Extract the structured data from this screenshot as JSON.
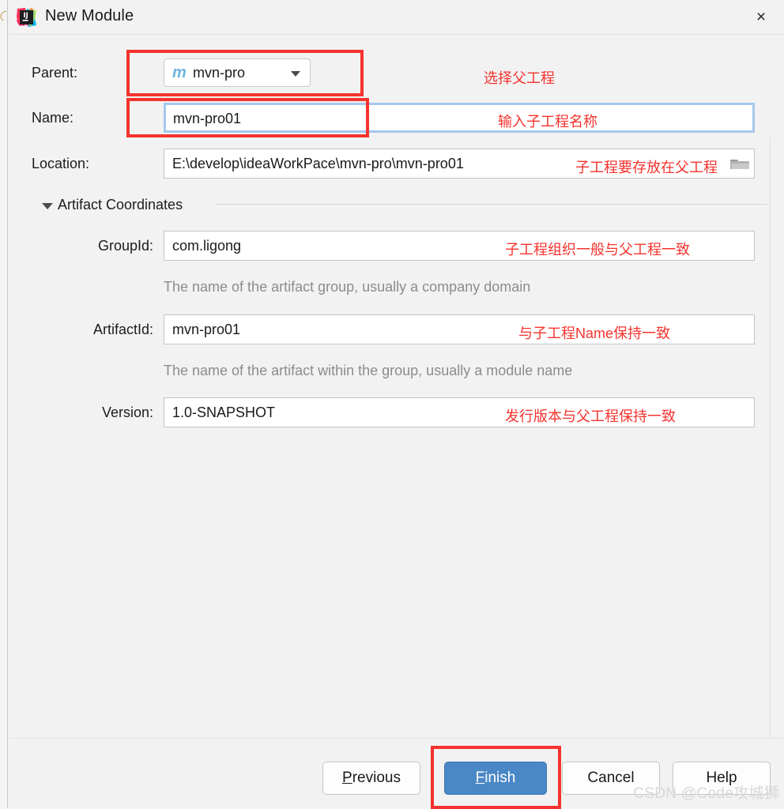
{
  "window": {
    "title": "New Module",
    "icon": "intellij-idea-icon",
    "close_label": "×"
  },
  "form": {
    "parent": {
      "label": "Parent:",
      "value": "mvn-pro",
      "icon_glyph": "m",
      "annotation": "选择父工程"
    },
    "name": {
      "label": "Name:",
      "value": "mvn-pro01",
      "annotation": "输入子工程名称"
    },
    "location": {
      "label": "Location:",
      "value": "E:\\develop\\ideaWorkPace\\mvn-pro\\mvn-pro01",
      "annotation": "子工程要存放在父工程"
    }
  },
  "artifact_section": {
    "title": "Artifact Coordinates",
    "expanded": true,
    "group_id": {
      "label": "GroupId:",
      "value": "com.ligong",
      "hint": "The name of the artifact group, usually a company domain",
      "annotation": "子工程组织一般与父工程一致"
    },
    "artifact_id": {
      "label": "ArtifactId:",
      "value": "mvn-pro01",
      "hint": "The name of the artifact within the group, usually a module name",
      "annotation": "与子工程Name保持一致"
    },
    "version": {
      "label": "Version:",
      "value": "1.0-SNAPSHOT",
      "annotation": "发行版本与父工程保持一致"
    }
  },
  "footer": {
    "previous": {
      "prefix": "",
      "mnemonic": "P",
      "rest": "revious"
    },
    "finish": {
      "prefix": "",
      "mnemonic": "F",
      "rest": "inish"
    },
    "cancel": "Cancel",
    "help": "Help"
  },
  "watermark": "CSDN @Code攻城狮",
  "colors": {
    "annotation_red": "#f5332e",
    "primary_button": "#4a87c6",
    "focus_blue": "#a5c8ec",
    "maven_m": "#6fb3de",
    "background": "#f2f2f2"
  }
}
